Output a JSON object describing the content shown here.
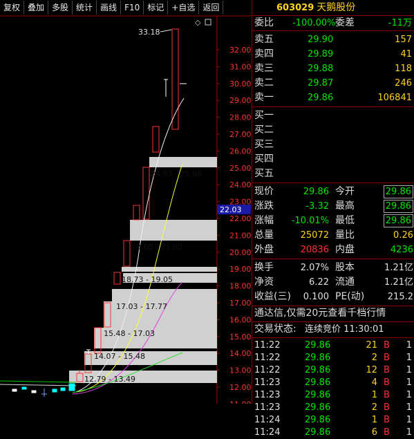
{
  "toolbar": {
    "items": [
      "复权",
      "叠加",
      "多股",
      "统计",
      "画线",
      "F10",
      "标记",
      "+自选",
      "返回"
    ]
  },
  "stock": {
    "code": "603029",
    "name": "天鹅股份"
  },
  "chart": {
    "price_ticks": [
      "32.00",
      "31.00",
      "30.00",
      "29.00",
      "28.00",
      "27.00",
      "26.00",
      "25.00",
      "24.00",
      "23.00",
      "22.00",
      "21.00",
      "20.00",
      "19.00",
      "18.00",
      "17.00",
      "16.00",
      "15.00",
      "14.00",
      "13.00",
      "12.00",
      "11.00"
    ],
    "current_marker": "22.03",
    "high_label": "33.18",
    "chip_labels": [
      "24.93 - 25.66",
      "20.60 - 21.80",
      "18.73 - 19.05",
      "17.03 - 17.77",
      "15.48 - 17.03",
      "14.07 - 15.48",
      "12.79 - 13.49"
    ],
    "diamond_icon": "◇"
  },
  "order_book": {
    "ratio_label": "委比",
    "ratio_value": "-100.00%",
    "diff_label": "委差",
    "diff_value": "-11万",
    "asks": [
      {
        "label": "卖五",
        "price": "29.90",
        "vol": "157"
      },
      {
        "label": "卖四",
        "price": "29.89",
        "vol": "41"
      },
      {
        "label": "卖三",
        "price": "29.88",
        "vol": "118"
      },
      {
        "label": "卖二",
        "price": "29.87",
        "vol": "246"
      },
      {
        "label": "卖一",
        "price": "29.86",
        "vol": "106841"
      }
    ],
    "bids": [
      {
        "label": "买一"
      },
      {
        "label": "买二"
      },
      {
        "label": "买三"
      },
      {
        "label": "买四"
      },
      {
        "label": "买五"
      }
    ]
  },
  "quote": {
    "rows": [
      {
        "l1": "现价",
        "v1": "29.86",
        "l2": "今开",
        "v2": "29.86"
      },
      {
        "l1": "涨跌",
        "v1": "-3.32",
        "l2": "最高",
        "v2": "29.86"
      },
      {
        "l1": "涨幅",
        "v1": "-10.01%",
        "l2": "最低",
        "v2": "29.86"
      },
      {
        "l1": "总量",
        "v1": "25072",
        "l2": "量比",
        "v2": "0.26"
      },
      {
        "l1": "外盘",
        "v1": "20836",
        "l2": "内盘",
        "v2": "4236"
      }
    ]
  },
  "fundamentals": {
    "rows": [
      {
        "l1": "换手",
        "v1": "2.07%",
        "l2": "股本",
        "v2": "1.21亿"
      },
      {
        "l1": "净资",
        "v1": "6.22",
        "l2": "流通",
        "v2": "1.21亿"
      },
      {
        "l1": "收益(三)",
        "v1": "0.100",
        "l2": "PE(动)",
        "v2": "215.2"
      }
    ]
  },
  "notice": "通达信,仅需20元查看千档行情",
  "status": {
    "label": "交易状态:",
    "value": "连续竞价 11:30:01"
  },
  "trades": [
    {
      "time": "11:22",
      "price": "29.86",
      "vol": "21",
      "bs": "B",
      "n": "1"
    },
    {
      "time": "11:22",
      "price": "29.86",
      "vol": "2",
      "bs": "B",
      "n": "1"
    },
    {
      "time": "11:22",
      "price": "29.86",
      "vol": "12",
      "bs": "B",
      "n": "1"
    },
    {
      "time": "11:23",
      "price": "29.86",
      "vol": "4",
      "bs": "B",
      "n": "1"
    },
    {
      "time": "11:23",
      "price": "29.86",
      "vol": "1",
      "bs": "B",
      "n": "1"
    },
    {
      "time": "11:23",
      "price": "29.86",
      "vol": "2",
      "bs": "B",
      "n": "1"
    },
    {
      "time": "11:24",
      "price": "29.86",
      "vol": "1",
      "bs": "B",
      "n": "1"
    },
    {
      "time": "11:24",
      "price": "29.86",
      "vol": "6",
      "bs": "B",
      "n": "1"
    }
  ],
  "colors": {
    "up": "#ff3232",
    "down": "#00e600",
    "label": "#ffd21f",
    "border": "#800000"
  }
}
